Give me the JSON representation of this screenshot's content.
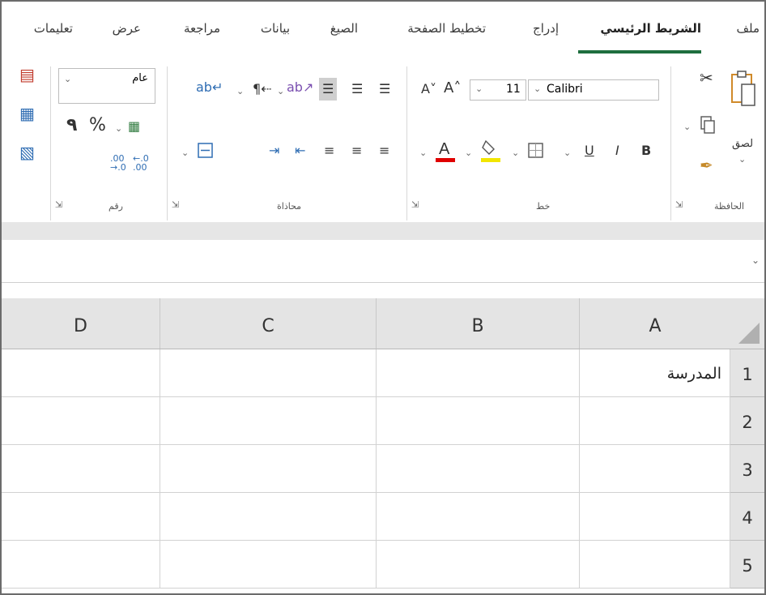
{
  "tabs": [
    {
      "label": "ملف",
      "active": false
    },
    {
      "label": "الشريط الرئيسي",
      "active": true
    },
    {
      "label": "إدراج",
      "active": false
    },
    {
      "label": "تخطيط الصفحة",
      "active": false
    },
    {
      "label": "الصيغ",
      "active": false
    },
    {
      "label": "بيانات",
      "active": false
    },
    {
      "label": "مراجعة",
      "active": false
    },
    {
      "label": "عرض",
      "active": false
    },
    {
      "label": "تعليمات",
      "active": false
    }
  ],
  "ribbon": {
    "clipboard": {
      "paste_label": "لصق",
      "group_label": "الحافظة"
    },
    "font": {
      "name": "Calibri",
      "size": "11",
      "group_label": "خط",
      "bold": "B",
      "italic": "I",
      "underline": "U"
    },
    "alignment": {
      "group_label": "محاذاة"
    },
    "number": {
      "format": "عام",
      "percent": "%",
      "comma": "٩",
      "group_label": "رقم"
    }
  },
  "sheet": {
    "columns": [
      "A",
      "B",
      "C",
      "D"
    ],
    "rows": [
      {
        "num": "1",
        "A": "المدرسة",
        "B": "",
        "C": "",
        "D": ""
      },
      {
        "num": "2",
        "A": "",
        "B": "",
        "C": "",
        "D": ""
      },
      {
        "num": "3",
        "A": "",
        "B": "",
        "C": "",
        "D": ""
      },
      {
        "num": "4",
        "A": "",
        "B": "",
        "C": "",
        "D": ""
      },
      {
        "num": "5",
        "A": "",
        "B": "",
        "C": "",
        "D": ""
      }
    ]
  },
  "colors": {
    "accent": "#1e6e3e",
    "font_color": "#e00000",
    "highlight": "#f2e600"
  }
}
